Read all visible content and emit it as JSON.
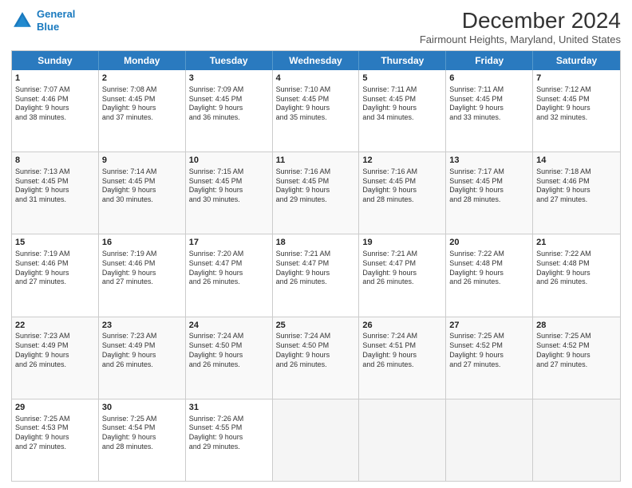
{
  "logo": {
    "line1": "General",
    "line2": "Blue"
  },
  "title": "December 2024",
  "subtitle": "Fairmount Heights, Maryland, United States",
  "weekdays": [
    "Sunday",
    "Monday",
    "Tuesday",
    "Wednesday",
    "Thursday",
    "Friday",
    "Saturday"
  ],
  "rows": [
    [
      {
        "day": "1",
        "text": "Sunrise: 7:07 AM\nSunset: 4:46 PM\nDaylight: 9 hours\nand 38 minutes."
      },
      {
        "day": "2",
        "text": "Sunrise: 7:08 AM\nSunset: 4:45 PM\nDaylight: 9 hours\nand 37 minutes."
      },
      {
        "day": "3",
        "text": "Sunrise: 7:09 AM\nSunset: 4:45 PM\nDaylight: 9 hours\nand 36 minutes."
      },
      {
        "day": "4",
        "text": "Sunrise: 7:10 AM\nSunset: 4:45 PM\nDaylight: 9 hours\nand 35 minutes."
      },
      {
        "day": "5",
        "text": "Sunrise: 7:11 AM\nSunset: 4:45 PM\nDaylight: 9 hours\nand 34 minutes."
      },
      {
        "day": "6",
        "text": "Sunrise: 7:11 AM\nSunset: 4:45 PM\nDaylight: 9 hours\nand 33 minutes."
      },
      {
        "day": "7",
        "text": "Sunrise: 7:12 AM\nSunset: 4:45 PM\nDaylight: 9 hours\nand 32 minutes."
      }
    ],
    [
      {
        "day": "8",
        "text": "Sunrise: 7:13 AM\nSunset: 4:45 PM\nDaylight: 9 hours\nand 31 minutes."
      },
      {
        "day": "9",
        "text": "Sunrise: 7:14 AM\nSunset: 4:45 PM\nDaylight: 9 hours\nand 30 minutes."
      },
      {
        "day": "10",
        "text": "Sunrise: 7:15 AM\nSunset: 4:45 PM\nDaylight: 9 hours\nand 30 minutes."
      },
      {
        "day": "11",
        "text": "Sunrise: 7:16 AM\nSunset: 4:45 PM\nDaylight: 9 hours\nand 29 minutes."
      },
      {
        "day": "12",
        "text": "Sunrise: 7:16 AM\nSunset: 4:45 PM\nDaylight: 9 hours\nand 28 minutes."
      },
      {
        "day": "13",
        "text": "Sunrise: 7:17 AM\nSunset: 4:45 PM\nDaylight: 9 hours\nand 28 minutes."
      },
      {
        "day": "14",
        "text": "Sunrise: 7:18 AM\nSunset: 4:46 PM\nDaylight: 9 hours\nand 27 minutes."
      }
    ],
    [
      {
        "day": "15",
        "text": "Sunrise: 7:19 AM\nSunset: 4:46 PM\nDaylight: 9 hours\nand 27 minutes."
      },
      {
        "day": "16",
        "text": "Sunrise: 7:19 AM\nSunset: 4:46 PM\nDaylight: 9 hours\nand 27 minutes."
      },
      {
        "day": "17",
        "text": "Sunrise: 7:20 AM\nSunset: 4:47 PM\nDaylight: 9 hours\nand 26 minutes."
      },
      {
        "day": "18",
        "text": "Sunrise: 7:21 AM\nSunset: 4:47 PM\nDaylight: 9 hours\nand 26 minutes."
      },
      {
        "day": "19",
        "text": "Sunrise: 7:21 AM\nSunset: 4:47 PM\nDaylight: 9 hours\nand 26 minutes."
      },
      {
        "day": "20",
        "text": "Sunrise: 7:22 AM\nSunset: 4:48 PM\nDaylight: 9 hours\nand 26 minutes."
      },
      {
        "day": "21",
        "text": "Sunrise: 7:22 AM\nSunset: 4:48 PM\nDaylight: 9 hours\nand 26 minutes."
      }
    ],
    [
      {
        "day": "22",
        "text": "Sunrise: 7:23 AM\nSunset: 4:49 PM\nDaylight: 9 hours\nand 26 minutes."
      },
      {
        "day": "23",
        "text": "Sunrise: 7:23 AM\nSunset: 4:49 PM\nDaylight: 9 hours\nand 26 minutes."
      },
      {
        "day": "24",
        "text": "Sunrise: 7:24 AM\nSunset: 4:50 PM\nDaylight: 9 hours\nand 26 minutes."
      },
      {
        "day": "25",
        "text": "Sunrise: 7:24 AM\nSunset: 4:50 PM\nDaylight: 9 hours\nand 26 minutes."
      },
      {
        "day": "26",
        "text": "Sunrise: 7:24 AM\nSunset: 4:51 PM\nDaylight: 9 hours\nand 26 minutes."
      },
      {
        "day": "27",
        "text": "Sunrise: 7:25 AM\nSunset: 4:52 PM\nDaylight: 9 hours\nand 27 minutes."
      },
      {
        "day": "28",
        "text": "Sunrise: 7:25 AM\nSunset: 4:52 PM\nDaylight: 9 hours\nand 27 minutes."
      }
    ],
    [
      {
        "day": "29",
        "text": "Sunrise: 7:25 AM\nSunset: 4:53 PM\nDaylight: 9 hours\nand 27 minutes."
      },
      {
        "day": "30",
        "text": "Sunrise: 7:25 AM\nSunset: 4:54 PM\nDaylight: 9 hours\nand 28 minutes."
      },
      {
        "day": "31",
        "text": "Sunrise: 7:26 AM\nSunset: 4:55 PM\nDaylight: 9 hours\nand 29 minutes."
      },
      {
        "day": "",
        "text": ""
      },
      {
        "day": "",
        "text": ""
      },
      {
        "day": "",
        "text": ""
      },
      {
        "day": "",
        "text": ""
      }
    ]
  ]
}
